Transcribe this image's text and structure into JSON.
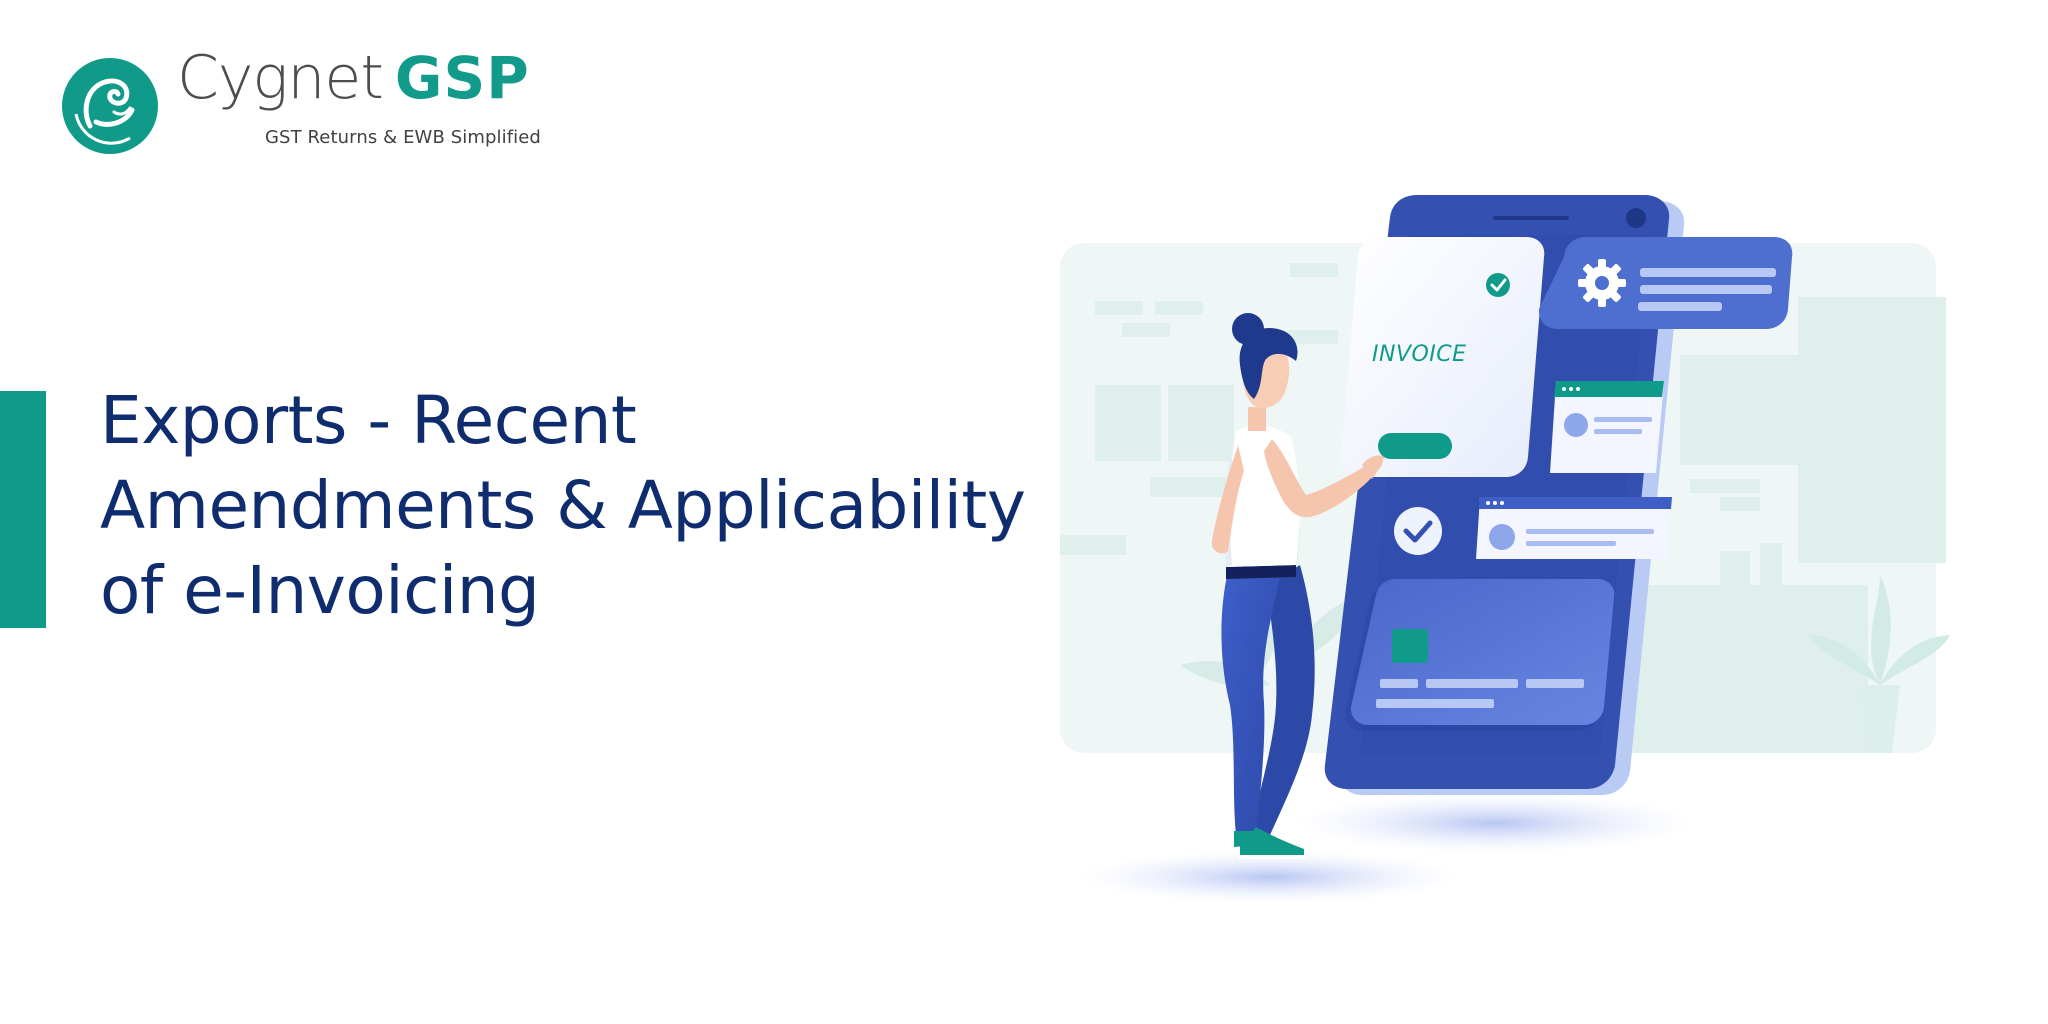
{
  "brand": {
    "name_light": "Cygnet",
    "name_bold": "GSP",
    "tagline": "GST Returns & EWB Simplified",
    "logo_icon": "swan-circle-logo",
    "colors": {
      "teal": "#0f9a8a",
      "navy": "#0f2d6e",
      "grey": "#4d4d4f"
    }
  },
  "title": {
    "lines": [
      "Exports - Recent",
      "Amendments & Applicability",
      "of e-Invoicing"
    ]
  },
  "illustration": {
    "invoice_label": "INVOICE",
    "icons": [
      "check-icon",
      "gear-icon",
      "check-circle-icon",
      "card-chip-icon",
      "plant-icon"
    ],
    "colors": {
      "phone": "#3451b2",
      "phone_light": "#b9caf5",
      "background_panel": "#eef7f5",
      "card": "#4f6fd0"
    }
  }
}
